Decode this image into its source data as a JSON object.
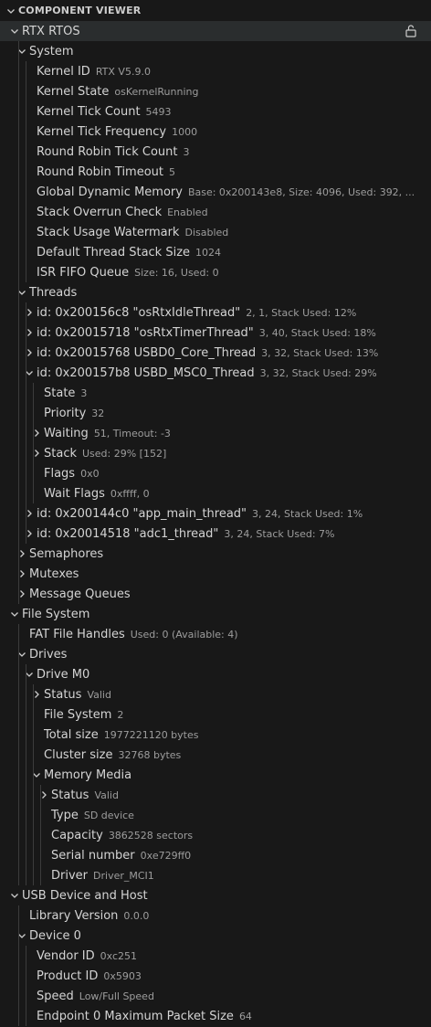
{
  "panel": {
    "title": "COMPONENT VIEWER"
  },
  "colors": {
    "background": "#181818",
    "label": "#d4d4d4",
    "value": "#9d9d9d",
    "selected": "#2a2d2e"
  },
  "tree": [
    {
      "label": "RTX RTOS",
      "value": "",
      "level": 0,
      "toggle": "open",
      "lock": true,
      "selected": true
    },
    {
      "label": "System",
      "value": "",
      "level": 1,
      "toggle": "open"
    },
    {
      "label": "Kernel ID",
      "value": "RTX V5.9.0",
      "level": 2,
      "toggle": "none"
    },
    {
      "label": "Kernel State",
      "value": "osKernelRunning",
      "level": 2,
      "toggle": "none"
    },
    {
      "label": "Kernel Tick Count",
      "value": "5493",
      "level": 2,
      "toggle": "none"
    },
    {
      "label": "Kernel Tick Frequency",
      "value": "1000",
      "level": 2,
      "toggle": "none"
    },
    {
      "label": "Round Robin Tick Count",
      "value": "3",
      "level": 2,
      "toggle": "none"
    },
    {
      "label": "Round Robin Timeout",
      "value": "5",
      "level": 2,
      "toggle": "none"
    },
    {
      "label": "Global Dynamic Memory",
      "value": "Base: 0x200143e8, Size: 4096, Used: 392, ...",
      "level": 2,
      "toggle": "none"
    },
    {
      "label": "Stack Overrun Check",
      "value": "Enabled",
      "level": 2,
      "toggle": "none"
    },
    {
      "label": "Stack Usage Watermark",
      "value": "Disabled",
      "level": 2,
      "toggle": "none"
    },
    {
      "label": "Default Thread Stack Size",
      "value": "1024",
      "level": 2,
      "toggle": "none"
    },
    {
      "label": "ISR FIFO Queue",
      "value": "Size: 16, Used: 0",
      "level": 2,
      "toggle": "none"
    },
    {
      "label": "Threads",
      "value": "",
      "level": 1,
      "toggle": "open"
    },
    {
      "label": "id: 0x200156c8 \"osRtxIdleThread\"",
      "value": "2, 1, Stack Used: 12%",
      "level": 2,
      "toggle": "closed"
    },
    {
      "label": "id: 0x20015718 \"osRtxTimerThread\"",
      "value": "3, 40, Stack Used: 18%",
      "level": 2,
      "toggle": "closed"
    },
    {
      "label": "id: 0x20015768 USBD0_Core_Thread",
      "value": "3, 32, Stack Used: 13%",
      "level": 2,
      "toggle": "closed"
    },
    {
      "label": "id: 0x200157b8 USBD_MSC0_Thread",
      "value": "3, 32, Stack Used: 29%",
      "level": 2,
      "toggle": "open"
    },
    {
      "label": "State",
      "value": "3",
      "level": 3,
      "toggle": "none"
    },
    {
      "label": "Priority",
      "value": "32",
      "level": 3,
      "toggle": "none"
    },
    {
      "label": "Waiting",
      "value": "51, Timeout: -3",
      "level": 3,
      "toggle": "closed"
    },
    {
      "label": "Stack",
      "value": "Used: 29% [152]",
      "level": 3,
      "toggle": "closed"
    },
    {
      "label": "Flags",
      "value": "0x0",
      "level": 3,
      "toggle": "none"
    },
    {
      "label": "Wait Flags",
      "value": "0xffff, 0",
      "level": 3,
      "toggle": "none"
    },
    {
      "label": "id: 0x200144c0 \"app_main_thread\"",
      "value": "3, 24, Stack Used: 1%",
      "level": 2,
      "toggle": "closed"
    },
    {
      "label": "id: 0x20014518 \"adc1_thread\"",
      "value": "3, 24, Stack Used: 7%",
      "level": 2,
      "toggle": "closed"
    },
    {
      "label": "Semaphores",
      "value": "",
      "level": 1,
      "toggle": "closed"
    },
    {
      "label": "Mutexes",
      "value": "",
      "level": 1,
      "toggle": "closed"
    },
    {
      "label": "Message Queues",
      "value": "",
      "level": 1,
      "toggle": "closed"
    },
    {
      "label": "File System",
      "value": "",
      "level": 0,
      "toggle": "open"
    },
    {
      "label": "FAT File Handles",
      "value": "Used: 0 (Available: 4)",
      "level": 1,
      "toggle": "none"
    },
    {
      "label": "Drives",
      "value": "",
      "level": 1,
      "toggle": "open"
    },
    {
      "label": "Drive M0",
      "value": "",
      "level": 2,
      "toggle": "open"
    },
    {
      "label": "Status",
      "value": "Valid",
      "level": 3,
      "toggle": "closed"
    },
    {
      "label": "File System",
      "value": "2",
      "level": 3,
      "toggle": "none"
    },
    {
      "label": "Total size",
      "value": "1977221120 bytes",
      "level": 3,
      "toggle": "none"
    },
    {
      "label": "Cluster size",
      "value": "32768 bytes",
      "level": 3,
      "toggle": "none"
    },
    {
      "label": "Memory Media",
      "value": "",
      "level": 3,
      "toggle": "open"
    },
    {
      "label": "Status",
      "value": "Valid",
      "level": 4,
      "toggle": "closed"
    },
    {
      "label": "Type",
      "value": "SD device",
      "level": 4,
      "toggle": "none"
    },
    {
      "label": "Capacity",
      "value": "3862528 sectors",
      "level": 4,
      "toggle": "none"
    },
    {
      "label": "Serial number",
      "value": "0xe729ff0",
      "level": 4,
      "toggle": "none"
    },
    {
      "label": "Driver",
      "value": "Driver_MCI1",
      "level": 4,
      "toggle": "none"
    },
    {
      "label": "USB Device and Host",
      "value": "",
      "level": 0,
      "toggle": "open"
    },
    {
      "label": "Library Version",
      "value": "0.0.0",
      "level": 1,
      "toggle": "none"
    },
    {
      "label": "Device 0",
      "value": "",
      "level": 1,
      "toggle": "open"
    },
    {
      "label": "Vendor ID",
      "value": "0xc251",
      "level": 2,
      "toggle": "none"
    },
    {
      "label": "Product ID",
      "value": "0x5903",
      "level": 2,
      "toggle": "none"
    },
    {
      "label": "Speed",
      "value": "Low/Full Speed",
      "level": 2,
      "toggle": "none"
    },
    {
      "label": "Endpoint 0 Maximum Packet Size",
      "value": "64",
      "level": 2,
      "toggle": "none"
    }
  ]
}
